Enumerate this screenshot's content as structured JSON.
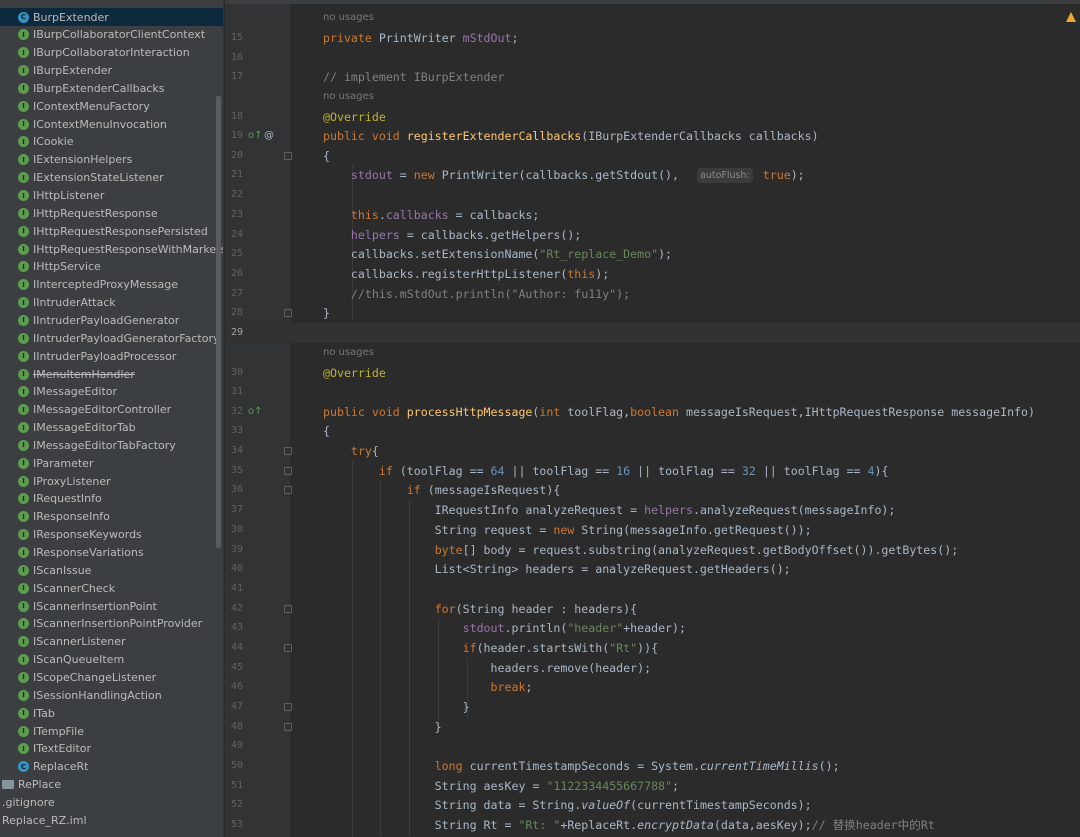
{
  "project_tree": {
    "items": [
      {
        "label": "BurpExtender",
        "kind": "class",
        "selected": true
      },
      {
        "label": "IBurpCollaboratorClientContext",
        "kind": "interface"
      },
      {
        "label": "IBurpCollaboratorInteraction",
        "kind": "interface"
      },
      {
        "label": "IBurpExtender",
        "kind": "interface"
      },
      {
        "label": "IBurpExtenderCallbacks",
        "kind": "interface"
      },
      {
        "label": "IContextMenuFactory",
        "kind": "interface"
      },
      {
        "label": "IContextMenuInvocation",
        "kind": "interface"
      },
      {
        "label": "ICookie",
        "kind": "interface"
      },
      {
        "label": "IExtensionHelpers",
        "kind": "interface"
      },
      {
        "label": "IExtensionStateListener",
        "kind": "interface"
      },
      {
        "label": "IHttpListener",
        "kind": "interface"
      },
      {
        "label": "IHttpRequestResponse",
        "kind": "interface"
      },
      {
        "label": "IHttpRequestResponsePersisted",
        "kind": "interface"
      },
      {
        "label": "IHttpRequestResponseWithMarkers",
        "kind": "interface"
      },
      {
        "label": "IHttpService",
        "kind": "interface"
      },
      {
        "label": "IInterceptedProxyMessage",
        "kind": "interface"
      },
      {
        "label": "IIntruderAttack",
        "kind": "interface"
      },
      {
        "label": "IIntruderPayloadGenerator",
        "kind": "interface"
      },
      {
        "label": "IIntruderPayloadGeneratorFactory",
        "kind": "interface"
      },
      {
        "label": "IIntruderPayloadProcessor",
        "kind": "interface"
      },
      {
        "label": "IMenuItemHandler",
        "kind": "interface",
        "deprecated": true
      },
      {
        "label": "IMessageEditor",
        "kind": "interface"
      },
      {
        "label": "IMessageEditorController",
        "kind": "interface"
      },
      {
        "label": "IMessageEditorTab",
        "kind": "interface"
      },
      {
        "label": "IMessageEditorTabFactory",
        "kind": "interface"
      },
      {
        "label": "IParameter",
        "kind": "interface"
      },
      {
        "label": "IProxyListener",
        "kind": "interface"
      },
      {
        "label": "IRequestInfo",
        "kind": "interface"
      },
      {
        "label": "IResponseInfo",
        "kind": "interface"
      },
      {
        "label": "IResponseKeywords",
        "kind": "interface"
      },
      {
        "label": "IResponseVariations",
        "kind": "interface"
      },
      {
        "label": "IScanIssue",
        "kind": "interface"
      },
      {
        "label": "IScannerCheck",
        "kind": "interface"
      },
      {
        "label": "IScannerInsertionPoint",
        "kind": "interface"
      },
      {
        "label": "IScannerInsertionPointProvider",
        "kind": "interface"
      },
      {
        "label": "IScannerListener",
        "kind": "interface"
      },
      {
        "label": "IScanQueueItem",
        "kind": "interface"
      },
      {
        "label": "IScopeChangeListener",
        "kind": "interface"
      },
      {
        "label": "ISessionHandlingAction",
        "kind": "interface"
      },
      {
        "label": "ITab",
        "kind": "interface"
      },
      {
        "label": "ITempFile",
        "kind": "interface"
      },
      {
        "label": "ITextEditor",
        "kind": "interface"
      },
      {
        "label": "ReplaceRt",
        "kind": "class"
      },
      {
        "label": "RePlace",
        "kind": "folder"
      },
      {
        "label": ".gitignore",
        "kind": "file"
      },
      {
        "label": "Replace_RZ.iml",
        "kind": "file"
      }
    ]
  },
  "editor": {
    "current_line": "29",
    "usage_hints": [
      "no usages",
      "no usages",
      "no usages"
    ],
    "param_hint": "autoFlush:",
    "lines": [
      {
        "n": "15",
        "html": "<span class=\"kw\">private </span>PrintWriter <span class=\"fd\">mStdOut</span>;"
      },
      {
        "n": "16",
        "html": ""
      },
      {
        "n": "17",
        "html": "<span class=\"cm\">// implement IBurpExtender</span>"
      },
      {
        "n": "18",
        "html": "<span class=\"an\">@Override</span>"
      },
      {
        "n": "19",
        "html": "<span class=\"kw\">public void </span><span class=\"mt\">registerExtenderCallbacks</span>(IBurpExtenderCallbacks callbacks)"
      },
      {
        "n": "20",
        "html": "{"
      },
      {
        "n": "21",
        "html": "    <span class=\"fd\">stdout</span> = <span class=\"kw\">new </span>PrintWriter(callbacks.getStdout(),            <span class=\"kw\">true</span>);"
      },
      {
        "n": "22",
        "html": ""
      },
      {
        "n": "23",
        "html": "    <span class=\"kw\">this</span>.<span class=\"fd\">callbacks</span> = callbacks;"
      },
      {
        "n": "24",
        "html": "    <span class=\"fd\">helpers</span> = callbacks.getHelpers();"
      },
      {
        "n": "25",
        "html": "    callbacks.setExtensionName(<span class=\"st\">\"Rt_replace_Demo\"</span>);"
      },
      {
        "n": "26",
        "html": "    callbacks.registerHttpListener(<span class=\"kw\">this</span>);"
      },
      {
        "n": "27",
        "html": "    <span class=\"cm\">//this.mStdOut.println(\"Author: fu11y\");</span>"
      },
      {
        "n": "28",
        "html": "}"
      },
      {
        "n": "29",
        "html": ""
      },
      {
        "n": "30",
        "html": "<span class=\"an\">@Override</span>"
      },
      {
        "n": "31",
        "html": ""
      },
      {
        "n": "32",
        "html": "<span class=\"kw\">public void </span><span class=\"mt\">processHttpMessage</span>(<span class=\"kw\">int </span>toolFlag,<span class=\"kw\">boolean </span>messageIsRequest,IHttpRequestResponse messageInfo)"
      },
      {
        "n": "33",
        "html": "{"
      },
      {
        "n": "34",
        "html": "    <span class=\"kw\">try</span>{"
      },
      {
        "n": "35",
        "html": "        <span class=\"kw\">if </span>(toolFlag == <span class=\"nb\">64 </span>|| toolFlag == <span class=\"nb\">16 </span>|| toolFlag == <span class=\"nb\">32 </span>|| toolFlag == <span class=\"nb\">4</span>){"
      },
      {
        "n": "36",
        "html": "            <span class=\"kw\">if </span>(messageIsRequest){"
      },
      {
        "n": "37",
        "html": "                IRequestInfo analyzeRequest = <span class=\"fd\">helpers</span>.analyzeRequest(messageInfo);"
      },
      {
        "n": "38",
        "html": "                String request = <span class=\"kw\">new </span>String(messageInfo.getRequest());"
      },
      {
        "n": "39",
        "html": "                <span class=\"kw\">byte</span>[] body = request.substring(analyzeRequest.getBodyOffset()).getBytes();"
      },
      {
        "n": "40",
        "html": "                List&lt;String&gt; headers = analyzeRequest.getHeaders();"
      },
      {
        "n": "41",
        "html": ""
      },
      {
        "n": "42",
        "html": "                <span class=\"kw\">for</span>(String header : headers){"
      },
      {
        "n": "43",
        "html": "                    <span class=\"fd\">stdout</span>.println(<span class=\"st\">\"header\"</span>+header);"
      },
      {
        "n": "44",
        "html": "                    <span class=\"kw\">if</span>(header.startsWith(<span class=\"st\">\"Rt\"</span>)){"
      },
      {
        "n": "45",
        "html": "                        headers.remove(header);"
      },
      {
        "n": "46",
        "html": "                        <span class=\"kw\">break</span>;"
      },
      {
        "n": "47",
        "html": "                    }"
      },
      {
        "n": "48",
        "html": "                }"
      },
      {
        "n": "49",
        "html": ""
      },
      {
        "n": "50",
        "html": "                <span class=\"kw\">long </span>currentTimestampSeconds = System.<span class=\"it\">currentTimeMillis</span>();"
      },
      {
        "n": "51",
        "html": "                String aesKey = <span class=\"st\">\"1122334455667788\"</span>;"
      },
      {
        "n": "52",
        "html": "                String data = String.<span class=\"it\">valueOf</span>(currentTimestampSeconds);"
      },
      {
        "n": "53",
        "html": "                String Rt = <span class=\"st\">\"Rt: \"</span>+ReplaceRt.<span class=\"it\">encryptData</span>(data,aesKey);<span class=\"cm\">// 替换header中的Rt</span>"
      }
    ]
  },
  "colors": {
    "editor_bg": "#2b2b2b",
    "tree_bg": "#3c3f41",
    "selection": "#0d293e",
    "keyword": "#cc7832",
    "annotation": "#bbb529",
    "string": "#6a8759",
    "field": "#9876aa",
    "method": "#ffc66d"
  }
}
